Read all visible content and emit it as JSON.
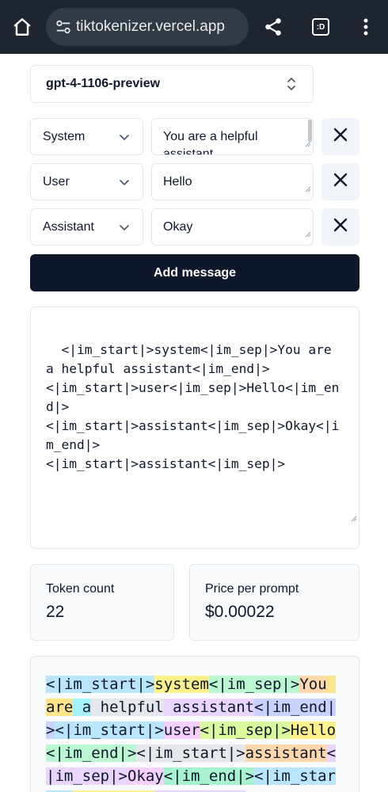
{
  "browser": {
    "url": "tiktokenizer.vercel.app",
    "icons": [
      "home-icon",
      "site-settings-icon",
      "share-icon",
      "tab-switcher-icon",
      "more-vert-icon"
    ],
    "tab_label": ":D"
  },
  "model_select": {
    "value": "gpt-4-1106-preview"
  },
  "messages": [
    {
      "role": "System",
      "content": "You are a helpful assistant"
    },
    {
      "role": "User",
      "content": "Hello"
    },
    {
      "role": "Assistant",
      "content": "Okay"
    }
  ],
  "add_message_label": "Add message",
  "prompt_text": "<|im_start|>system<|im_sep|>You are a helpful assistant<|im_end|>\n<|im_start|>user<|im_sep|>Hello<|im_end|>\n<|im_start|>assistant<|im_sep|>Okay<|im_end|>\n<|im_start|>assistant<|im_sep|>",
  "stats": {
    "token_count_label": "Token count",
    "token_count": "22",
    "price_label": "Price per prompt",
    "price": "$0.00022"
  },
  "tokens": [
    {
      "text": "<|im_start|>",
      "color": "#bae6fd"
    },
    {
      "text": "system",
      "color": "#fef08a"
    },
    {
      "text": "<|im_sep|>",
      "color": "#bbf7d0"
    },
    {
      "text": "You",
      "color": "#fed7aa"
    },
    {
      "text": " are",
      "color": "#fde68a"
    },
    {
      "text": " a",
      "color": "#a5f3fc"
    },
    {
      "text": " helpful",
      "color": "#e5e7eb"
    },
    {
      "text": " assistant",
      "color": "#e9d5ff"
    },
    {
      "text": "<|im_end|>",
      "color": "#c7d2fe"
    },
    {
      "text": "<|im_start|>",
      "color": "#bae6fd"
    },
    {
      "text": "user",
      "color": "#f5d0fe"
    },
    {
      "text": "<|im_sep|>",
      "color": "#d9f99d"
    },
    {
      "text": "Hello",
      "color": "#fef08a"
    },
    {
      "text": "<|im_end|>",
      "color": "#bbf7d0"
    },
    {
      "text": "<|im_start|>",
      "color": "#e5e7eb"
    },
    {
      "text": "assistant",
      "color": "#fed7aa"
    },
    {
      "text": "<|im_sep|>",
      "color": "#e9d5ff"
    },
    {
      "text": "Okay",
      "color": "#f5d0fe"
    },
    {
      "text": "<|im_end|>",
      "color": "#a7f3d0"
    },
    {
      "text": "<|im_start|>",
      "color": "#bae6fd"
    },
    {
      "text": "assistant",
      "color": "#fef08a"
    },
    {
      "text": "<|im_sep|>",
      "color": "#e9d5ff"
    }
  ]
}
